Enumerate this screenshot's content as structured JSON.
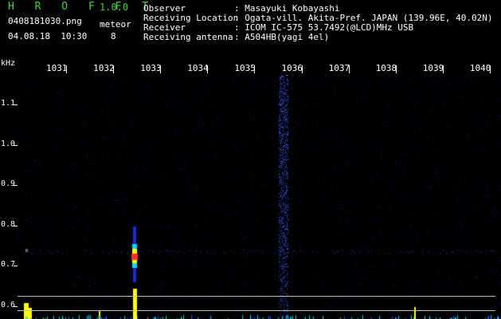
{
  "app": {
    "name": "H R O F F T",
    "version": "1.0.0",
    "filename": "0408181030.png",
    "datetime": "04.08.18  10:30",
    "meteor_label": "meteor",
    "meteor_count": "8"
  },
  "info": [
    {
      "label": "Observer",
      "value": ": Masayuki Kobayashi"
    },
    {
      "label": "Receiving Location",
      "value": ": Ogata-vill. Akita-Pref. JAPAN (139.96E, 40.02N)"
    },
    {
      "label": "Receiver",
      "value": ": ICOM IC-575 53.7492(@LCD)MHz USB"
    },
    {
      "label": "Receiving antenna",
      "value": ": A504HB(yagi 4el)"
    }
  ],
  "axes": {
    "khz_label": "kHz",
    "y_ticks": [
      "1.1",
      "1.0",
      "0.9",
      "0.8",
      "0.7",
      "0.6"
    ],
    "x_ticks": [
      "1031",
      "1032",
      "1033",
      "1034",
      "1035",
      "1036",
      "1037",
      "1038",
      "1039",
      "1040"
    ]
  },
  "colors": {
    "background": "#000000",
    "title_green": "#3fd43f",
    "text_white": "#ffffff",
    "noise_blue": "#1a1a8c",
    "bright_blue": "#3a4cff",
    "meteor_red": "#ff3030",
    "meteor_yellow": "#ffff00",
    "cyan": "#00ffff"
  }
}
